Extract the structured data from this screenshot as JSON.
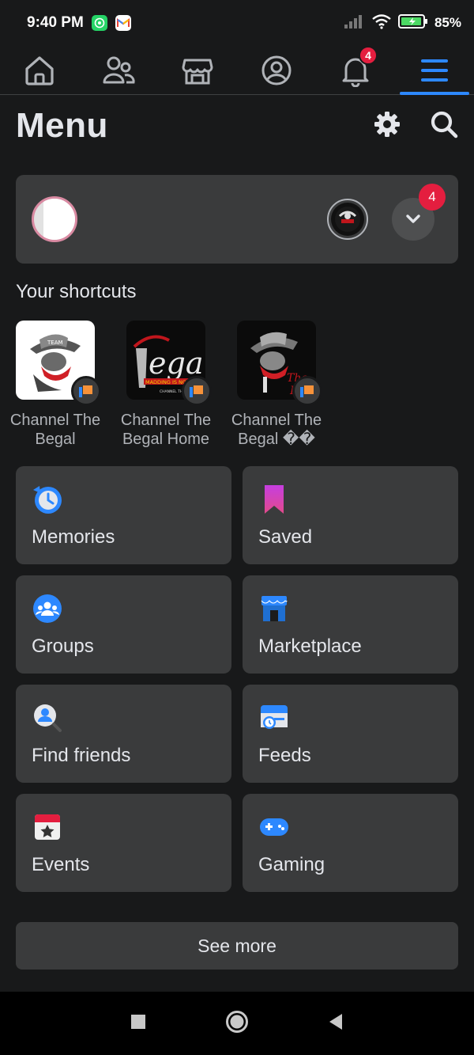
{
  "status_bar": {
    "time": "9:40 PM",
    "battery": "85%",
    "apps": [
      {
        "name": "whatsapp-icon",
        "color": "#25d366"
      },
      {
        "name": "gmail-icon",
        "color": "#ffffff"
      }
    ]
  },
  "nav": {
    "notifications_badge": "4",
    "active_tab": "menu",
    "accent": "#2d88ff"
  },
  "header": {
    "title": "Menu"
  },
  "profile": {
    "dropdown_badge": "4"
  },
  "shortcuts": {
    "title": "Your shortcuts",
    "items": [
      {
        "label": "Channel The Begal"
      },
      {
        "label": "Channel The Begal Home"
      },
      {
        "label": "Channel The Begal ��"
      }
    ]
  },
  "tiles": [
    {
      "label": "Memories",
      "icon": "memories-icon"
    },
    {
      "label": "Saved",
      "icon": "saved-icon"
    },
    {
      "label": "Groups",
      "icon": "groups-icon"
    },
    {
      "label": "Marketplace",
      "icon": "marketplace-icon"
    },
    {
      "label": "Find friends",
      "icon": "find-friends-icon"
    },
    {
      "label": "Feeds",
      "icon": "feeds-icon"
    },
    {
      "label": "Events",
      "icon": "events-icon"
    },
    {
      "label": "Gaming",
      "icon": "gaming-icon"
    }
  ],
  "see_more": "See more"
}
